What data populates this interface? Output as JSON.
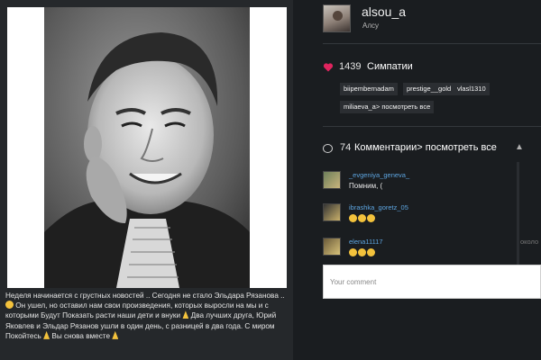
{
  "profile": {
    "username": "alsou_a",
    "full_name": "Алсу"
  },
  "caption": {
    "part1": "Неделя начинается с грустных новостей .. Сегодня не стало Эльдара Рязанова ..",
    "part2": "Он ушел, но оставил нам свои произведения, которых выросли на мы и с которыми Будут Показать расти наши дети и внуки",
    "part3": "Два лучших друга, Юрий Яковлев и Эльдар Рязанов ушли в один день, с разницей в два года. С миром Покойтесь",
    "part4": "Вы снова вместе"
  },
  "likes": {
    "count": "1439",
    "label": "Симпатии",
    "users": [
      "biipembernadam",
      "prestige__gold",
      "vlasl1310"
    ],
    "more_user": "miliaeva_a",
    "more_suffix": "> посмотреть все"
  },
  "comments": {
    "count": "74",
    "link": "Комментарии> посмотреть все",
    "items": [
      {
        "user": "_evgeniya_geneva_",
        "text": "Помним, (",
        "time": ""
      },
      {
        "user": "ibrashka_goretz_05",
        "text": "",
        "time": ""
      },
      {
        "user": "elena11117",
        "text": "",
        "time": "около"
      }
    ],
    "input_placeholder": "Your comment"
  },
  "colors": {
    "link": "#5da5e0",
    "heart": "#e0245e",
    "background": "#1a1d20",
    "panel": "#25282b"
  },
  "icons": {
    "likes": "heart-icon",
    "comments": "speech-bubble-icon",
    "scroll": "chevron-up-icon"
  }
}
